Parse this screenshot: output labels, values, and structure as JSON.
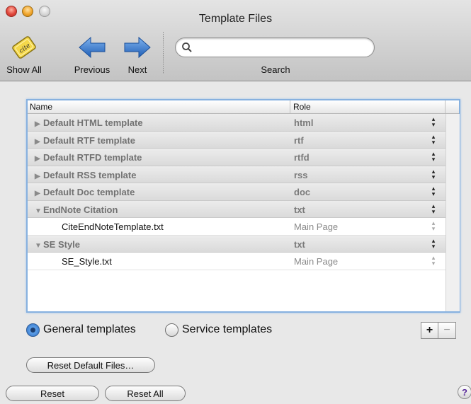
{
  "window": {
    "title": "Template Files"
  },
  "toolbar": {
    "show_all": {
      "label": "Show All",
      "icon": "cite-badge-icon",
      "badge_text": "cite"
    },
    "previous": {
      "label": "Previous",
      "icon": "arrow-left-icon"
    },
    "next": {
      "label": "Next",
      "icon": "arrow-right-icon"
    },
    "search": {
      "label": "Search",
      "value": "",
      "placeholder": ""
    },
    "accent_color": "#2f6cc2"
  },
  "table": {
    "headers": {
      "name": "Name",
      "role": "Role"
    },
    "rows": [
      {
        "name": "Default HTML template",
        "role": "html",
        "type": "group",
        "expanded": false
      },
      {
        "name": "Default RTF template",
        "role": "rtf",
        "type": "group",
        "expanded": false
      },
      {
        "name": "Default RTFD template",
        "role": "rtfd",
        "type": "group",
        "expanded": false
      },
      {
        "name": "Default RSS template",
        "role": "rss",
        "type": "group",
        "expanded": false
      },
      {
        "name": "Default Doc template",
        "role": "doc",
        "type": "group",
        "expanded": false
      },
      {
        "name": "EndNote Citation",
        "role": "txt",
        "type": "group",
        "expanded": true
      },
      {
        "name": "CiteEndNoteTemplate.txt",
        "role": "Main Page",
        "type": "leaf"
      },
      {
        "name": "SE Style",
        "role": "txt",
        "type": "group",
        "expanded": true
      },
      {
        "name": "SE_Style.txt",
        "role": "Main Page",
        "type": "leaf"
      }
    ]
  },
  "filter": {
    "general": {
      "label": "General  templates",
      "selected": true
    },
    "service": {
      "label": "Service templates",
      "selected": false
    }
  },
  "add_remove": {
    "add": "+",
    "remove": "−"
  },
  "buttons": {
    "reset_default_files": "Reset Default Files…",
    "reset": "Reset",
    "reset_all": "Reset All",
    "help": "?"
  }
}
